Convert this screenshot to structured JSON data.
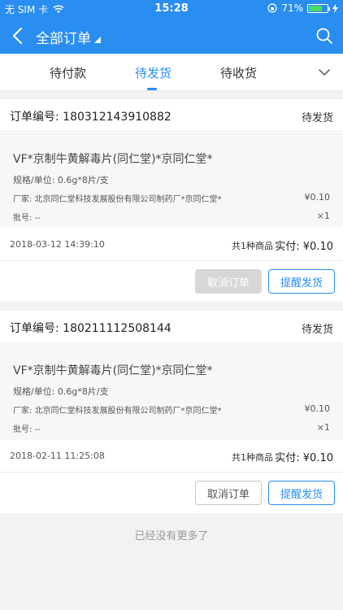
{
  "status_bar": {
    "carrier": "无 SIM 卡",
    "time": "15:28",
    "battery_percent": "71%",
    "battery_level": 0.71
  },
  "nav": {
    "title": "全部订单"
  },
  "tabs": [
    {
      "label": "待付款",
      "active": false
    },
    {
      "label": "待发货",
      "active": true
    },
    {
      "label": "待收货",
      "active": false
    }
  ],
  "orders": [
    {
      "order_no_label": "订单编号: 180312143910882",
      "status": "待发货",
      "product": {
        "name": "VF*京制牛黄解毒片(同仁堂)*京同仁堂*",
        "spec": "规格/单位: 0.6g*8片/支",
        "manufacturer": "厂家: 北京同仁堂科技发展股份有限公司制药厂*京同仁堂*",
        "price": "¥0.10",
        "batch": "批号: --",
        "qty": "×1"
      },
      "date": "2018-03-12 14:39:10",
      "count": "共1种商品",
      "paid": "实付: ¥0.10",
      "cancel_label": "取消订单",
      "cancel_disabled": true,
      "remind_label": "提醒发货"
    },
    {
      "order_no_label": "订单编号: 180211112508144",
      "status": "待发货",
      "product": {
        "name": "VF*京制牛黄解毒片(同仁堂)*京同仁堂*",
        "spec": "规格/单位: 0.6g*8片/支",
        "manufacturer": "厂家: 北京同仁堂科技发展股份有限公司制药厂*京同仁堂*",
        "price": "¥0.10",
        "batch": "批号: --",
        "qty": "×1"
      },
      "date": "2018-02-11 11:25:08",
      "count": "共1种商品",
      "paid": "实付: ¥0.10",
      "cancel_label": "取消订单",
      "cancel_disabled": false,
      "remind_label": "提醒发货"
    }
  ],
  "footer": {
    "no_more": "已经没有更多了"
  },
  "colors": {
    "primary": "#2a8ef0",
    "battery": "#4cd964"
  },
  "icons": [
    "signal-icon",
    "wifi-icon",
    "battery-icon",
    "back-icon",
    "search-icon",
    "chevron-down-icon",
    "orientation-lock-icon",
    "charging-icon"
  ]
}
